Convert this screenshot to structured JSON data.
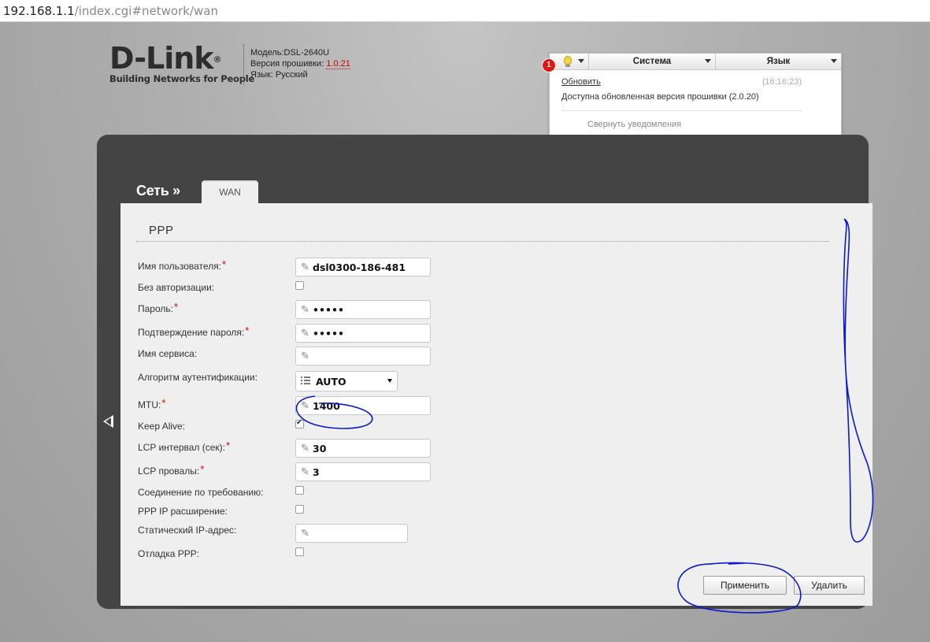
{
  "browser": {
    "host": "192.168.1.1",
    "path": "/index.cgi#network/wan"
  },
  "header": {
    "logo_text": "D-Link",
    "logo_reg": "®",
    "tagline": "Building Networks for People",
    "model": "Модель:DSL-2640U",
    "firmware_label": "Версия прошивки:",
    "firmware_value": "1.0.21",
    "language": "Язык: Русский"
  },
  "notifications": {
    "badge": "1",
    "system_menu": "Система",
    "language_menu": "Язык",
    "update_link": "Обновить",
    "time": "(16:16:23)",
    "message": "Доступна обновленная версия прошивки (2.0.20)",
    "collapse": "Свернуть уведомления"
  },
  "nav": {
    "breadcrumb": "Сеть »",
    "tab": "WAN"
  },
  "section": {
    "title": "PPP"
  },
  "form": {
    "username_label": "Имя пользователя:",
    "username_value": "dsl0300-186-481",
    "noauth_label": "Без авторизации:",
    "password_label": "Пароль:",
    "password_value": "•••••",
    "confirm_label": "Подтверждение пароля:",
    "confirm_value": "•••••",
    "service_label": "Имя сервиса:",
    "service_value": "",
    "auth_label": "Алгоритм аутентификации:",
    "auth_value": "AUTO",
    "mtu_label": "MTU:",
    "mtu_value": "1400",
    "keepalive_label": "Keep Alive:",
    "lcp_interval_label": "LCP интервал (сек):",
    "lcp_interval_value": "30",
    "lcp_fails_label": "LCP провалы:",
    "lcp_fails_value": "3",
    "ondemand_label": "Соединение по требованию:",
    "pppip_label": "PPP IP расширение:",
    "staticip_label": "Статический IP-адрес:",
    "staticip_value": "",
    "debug_label": "Отладка PPP:"
  },
  "checkboxes": {
    "noauth": false,
    "keepalive": true,
    "ondemand": false,
    "pppip": false,
    "debug": false
  },
  "buttons": {
    "apply": "Применить",
    "delete": "Удалить"
  },
  "colors": {
    "required": "#d00000",
    "panel": "#444444",
    "annotation": "#0a1acb",
    "badge": "#e01515"
  },
  "icons": {
    "field": "pencil-icon",
    "select": "list-icon",
    "notify": "lightbulb-icon",
    "back": "back-arrow-icon"
  }
}
